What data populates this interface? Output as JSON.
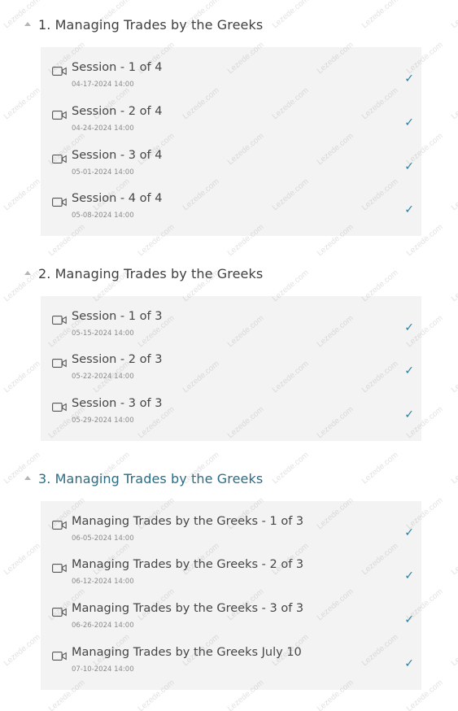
{
  "sections": [
    {
      "title": "1. Managing Trades by the Greeks",
      "sessions": [
        {
          "title": "Session - 1 of 4",
          "date": "04-17-2024 14:00",
          "check": "✓"
        },
        {
          "title": "Session - 2 of 4",
          "date": "04-24-2024 14:00",
          "check": "✓"
        },
        {
          "title": "Session - 3 of 4",
          "date": "05-01-2024 14:00",
          "check": "✓"
        },
        {
          "title": "Session - 4 of 4",
          "date": "05-08-2024 14:00",
          "check": "✓"
        }
      ]
    },
    {
      "title": "2. Managing Trades by the Greeks",
      "sessions": [
        {
          "title": "Session - 1 of 3",
          "date": "05-15-2024 14:00",
          "check": "✓"
        },
        {
          "title": "Session - 2 of 3",
          "date": "05-22-2024 14:00",
          "check": "✓"
        },
        {
          "title": "Session - 3 of 3",
          "date": "05-29-2024 14:00",
          "check": "✓"
        }
      ]
    },
    {
      "title": "3. Managing Trades by the Greeks",
      "sessions": [
        {
          "title": "Managing Trades by the Greeks - 1 of 3",
          "date": "06-05-2024 14:00",
          "check": "✓"
        },
        {
          "title": "Managing Trades by the Greeks - 2 of 3",
          "date": "06-12-2024 14:00",
          "check": "✓"
        },
        {
          "title": "Managing Trades by the Greeks - 3 of 3",
          "date": "06-26-2024 14:00",
          "check": "✓"
        },
        {
          "title": "Managing Trades by the Greeks July 10",
          "date": "07-10-2024 14:00",
          "check": "✓"
        }
      ]
    }
  ],
  "watermark": "Lezede.com",
  "colors": {
    "panel_bg": "#f3f3f3",
    "active_title": "#2a6c86",
    "check": "#2a7fa0"
  },
  "icons": {
    "session": "video-camera-icon",
    "complete": "check-icon",
    "expand": "caret-up-icon"
  }
}
